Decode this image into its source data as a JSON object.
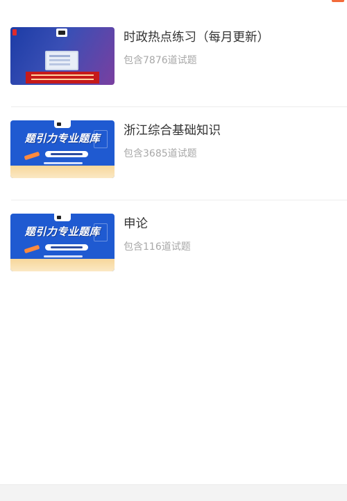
{
  "courses": [
    {
      "title": "时政热点练习（每月更新）",
      "count": "包含7876道试题",
      "thumb_slogan": ""
    },
    {
      "title": "浙江综合基础知识",
      "count": "包含3685道试题",
      "thumb_slogan": "题引力专业题库"
    },
    {
      "title": "申论",
      "count": "包含116道试题",
      "thumb_slogan": "题引力专业题库"
    }
  ],
  "colors": {
    "accent": "#f26b3a",
    "title": "#333333",
    "count": "#a8a8a8",
    "thumb_blue": "#1f5ad1"
  }
}
